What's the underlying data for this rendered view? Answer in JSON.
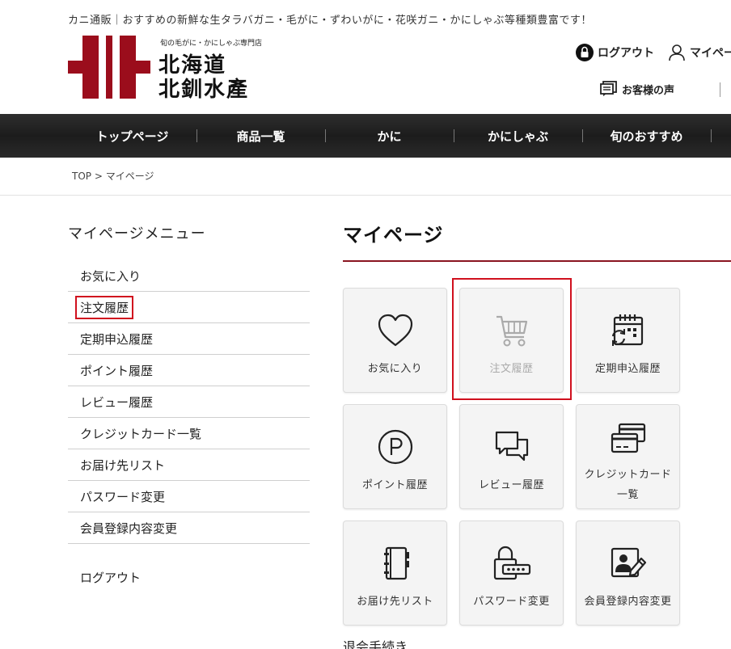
{
  "header": {
    "tagline": "カニ通販｜おすすめの新鮮な生タラバガニ・毛がに・ずわいがに・花咲ガニ・かにしゃぶ等種類豊富です！",
    "logo": {
      "sub": "旬の毛がに・かにしゃぶ専門店",
      "line1": "北海道",
      "line2": "北釧水產"
    },
    "logout": "ログアウト",
    "mypage": "マイペー",
    "voice": "お客様の声"
  },
  "nav": [
    "トップページ",
    "商品一覧",
    "かに",
    "かにしゃぶ",
    "旬のおすすめ"
  ],
  "breadcrumb": {
    "home": "TOP",
    "sep": ">",
    "current": "マイページ"
  },
  "sidebar": {
    "title": "マイページメニュー",
    "items": [
      {
        "label": "お気に入り"
      },
      {
        "label": "注文履歴",
        "highlighted": true
      },
      {
        "label": "定期申込履歴"
      },
      {
        "label": "ポイント履歴"
      },
      {
        "label": "レビュー履歴"
      },
      {
        "label": "クレジットカード一覧"
      },
      {
        "label": "お届け先リスト"
      },
      {
        "label": "パスワード変更"
      },
      {
        "label": "会員登録内容変更"
      }
    ],
    "logout": "ログアウト"
  },
  "main": {
    "title": "マイページ",
    "tiles": [
      {
        "label": "お気に入り",
        "icon": "heart-icon"
      },
      {
        "label": "注文履歴",
        "icon": "cart-icon",
        "highlighted": true
      },
      {
        "label": "定期申込履歴",
        "icon": "calendar-repeat-icon"
      },
      {
        "label": "ポイント履歴",
        "icon": "point-icon"
      },
      {
        "label": "レビュー履歴",
        "icon": "chat-icon"
      },
      {
        "label": "クレジットカード一覧",
        "label_line1": "クレジットカード",
        "label_line2": "一覧",
        "icon": "credit-card-icon"
      },
      {
        "label": "お届け先リスト",
        "icon": "address-book-icon"
      },
      {
        "label": "パスワード変更",
        "icon": "password-lock-icon"
      },
      {
        "label": "会員登録内容変更",
        "icon": "profile-edit-icon"
      }
    ],
    "withdraw": "退会手続き"
  },
  "colors": {
    "accent": "#8a1520",
    "highlight": "#d0101e",
    "logo_red": "#9b0d1c",
    "nav_bg": "#222222"
  }
}
